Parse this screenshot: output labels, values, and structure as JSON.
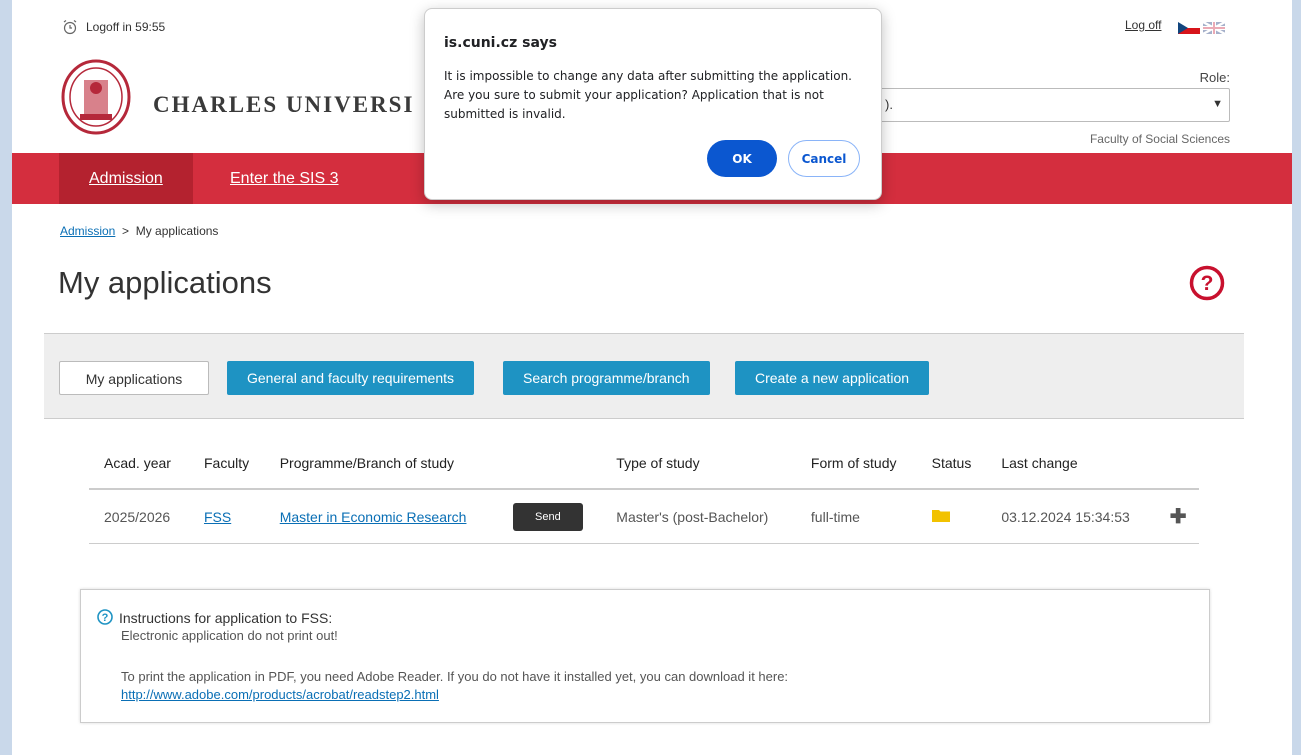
{
  "topbar": {
    "logoff_timer": "Logoff in 59:55",
    "logoff_link": "Log off",
    "languages": [
      "cz-flag-icon",
      "uk-flag-icon"
    ]
  },
  "header": {
    "university_name": "CHARLES UNIVERSI",
    "role_label": "Role:",
    "role_value": ").",
    "faculty": "Faculty of Social Sciences"
  },
  "nav": {
    "items": [
      {
        "label": "Admission"
      },
      {
        "label": "Enter the SIS 3"
      }
    ]
  },
  "breadcrumb": {
    "root": "Admission",
    "separator": ">",
    "current": "My applications"
  },
  "page_title": "My applications",
  "tabs": {
    "my_applications": "My applications",
    "requirements": "General and faculty requirements",
    "search": "Search programme/branch",
    "create": "Create a new application"
  },
  "table": {
    "headers": [
      "Acad. year",
      "Faculty",
      "Programme/Branch of study",
      "",
      "Type of study",
      "Form of study",
      "Status",
      "Last change",
      ""
    ],
    "rows": [
      {
        "year": "2025/2026",
        "faculty": "FSS",
        "programme": "Master in Economic Research",
        "action": "Send",
        "type": "Master's (post-Bachelor)",
        "form": "full-time",
        "status_icon": "folder-icon",
        "last_change": "03.12.2024 15:34:53"
      }
    ]
  },
  "instructions": {
    "title": "Instructions for application to FSS:",
    "line1": "Electronic application do not print out!",
    "line2": "To print the application in PDF, you need Adobe Reader. If you do not have it installed yet, you can download it here:",
    "link": "http://www.adobe.com/products/acrobat/readstep2.html"
  },
  "dialog": {
    "title": "is.cuni.cz says",
    "message": "It is impossible to change any data after submitting the application. Are you sure to submit your application? Application that is not submitted is invalid.",
    "ok": "OK",
    "cancel": "Cancel"
  },
  "colors": {
    "nav_red": "#d42e3e",
    "nav_active": "#b4222f",
    "tab_blue": "#1e93c3",
    "help_red": "#c8102e",
    "dialog_blue": "#0b57d0"
  }
}
